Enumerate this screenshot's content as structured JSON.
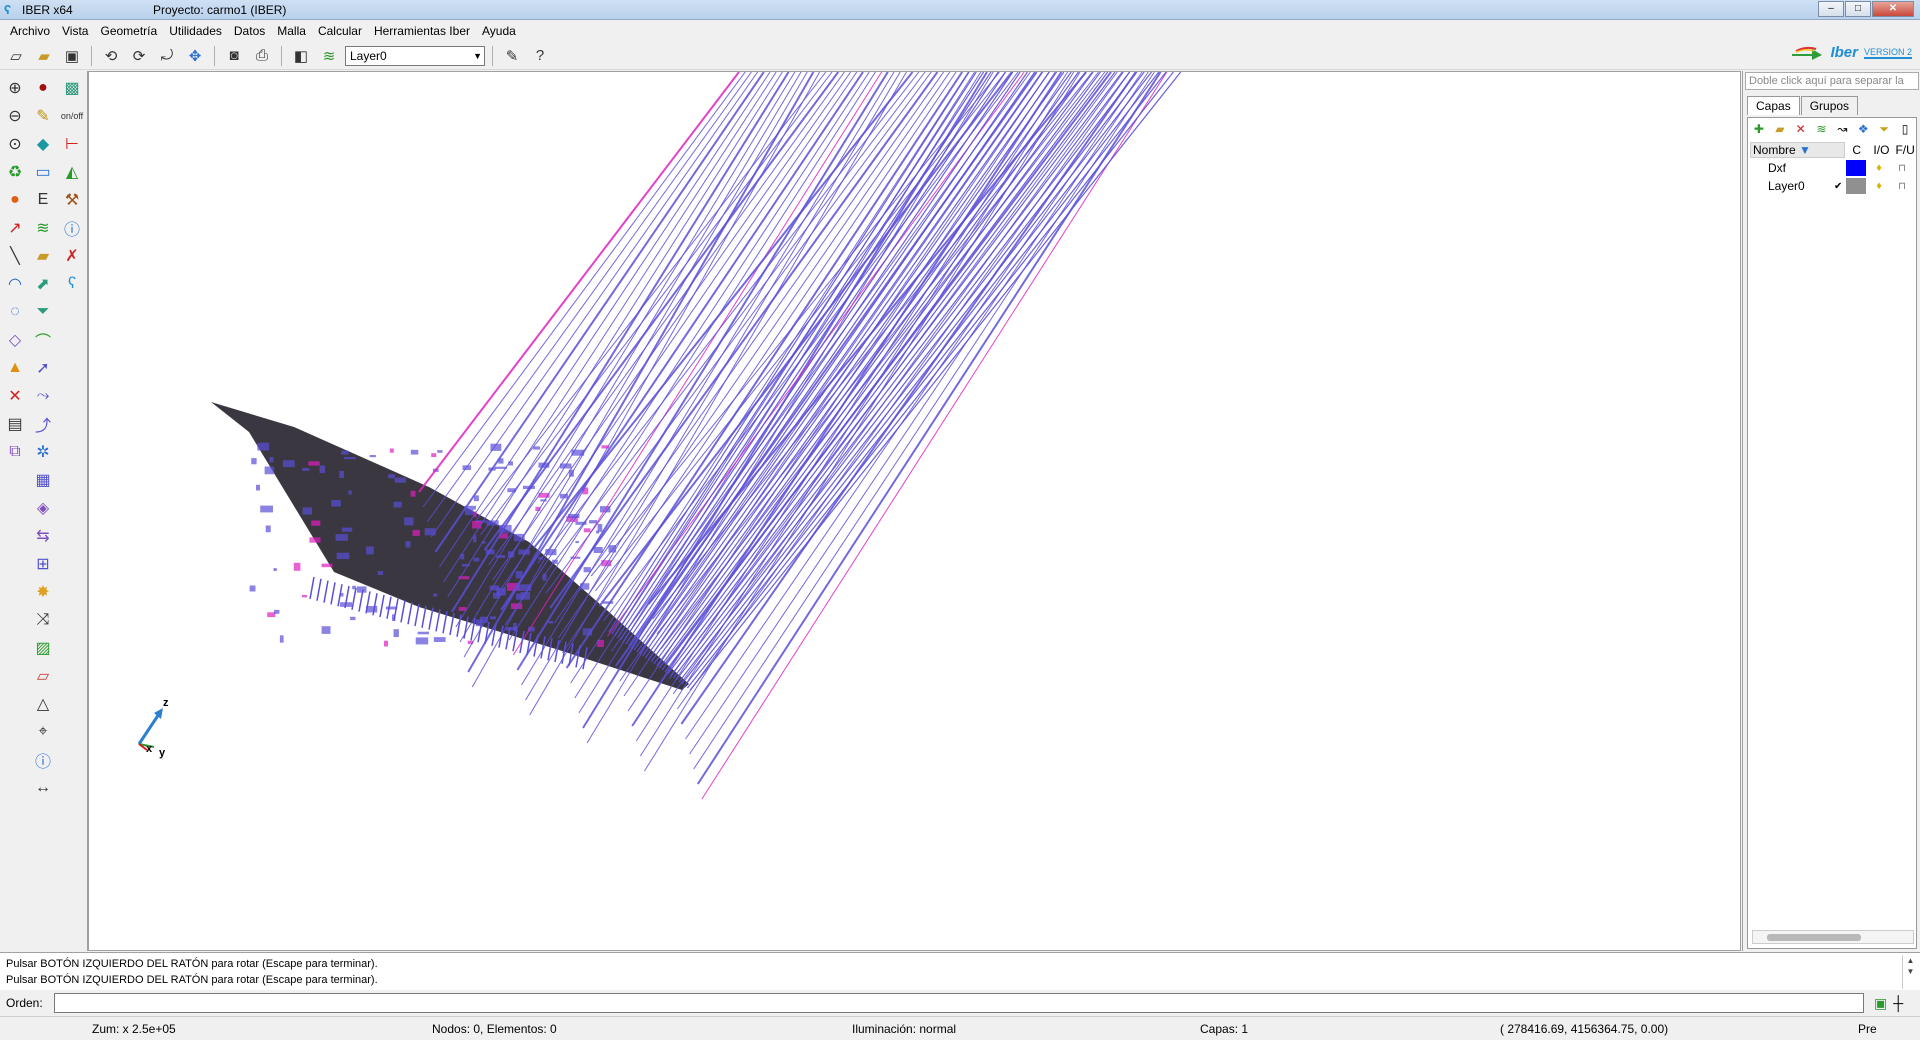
{
  "window": {
    "app_title": "IBER x64",
    "project_title": "Proyecto: carmo1 (IBER)",
    "buttons": {
      "minimize": "–",
      "maximize": "□",
      "close": "✕"
    }
  },
  "menu": [
    {
      "label": "Archivo"
    },
    {
      "label": "Vista"
    },
    {
      "label": "Geometría"
    },
    {
      "label": "Utilidades"
    },
    {
      "label": "Datos"
    },
    {
      "label": "Malla"
    },
    {
      "label": "Calcular"
    },
    {
      "label": "Herramientas Iber"
    },
    {
      "label": "Ayuda"
    }
  ],
  "toolbar": {
    "layer_value": "Layer0",
    "icons": [
      "new-file-icon",
      "open-folder-icon",
      "save-icon",
      "rotate-icon",
      "rotate-screen-icon",
      "rotate-center-icon",
      "pan-icon",
      "camera-icon",
      "print-icon",
      "layers-icon",
      "layers-stack-icon",
      "edit-icon",
      "help-icon"
    ],
    "brand": {
      "name": "Iber",
      "version": "VERSION 2"
    }
  },
  "right_panel": {
    "hint": "Doble click aquí para separar la",
    "tabs": [
      {
        "label": "Capas"
      },
      {
        "label": "Grupos"
      }
    ],
    "columns": {
      "name": "Nombre",
      "color": "C",
      "io": "I/O",
      "fu": "F/U"
    },
    "layers": [
      {
        "name": "Dxf",
        "checked": "",
        "color": "#0000ff"
      },
      {
        "name": "Layer0",
        "checked": "✔",
        "color": "#909090"
      }
    ]
  },
  "axes": {
    "z": "z",
    "x": "x",
    "y": "y"
  },
  "messages": [
    "Pulsar BOTÓN IZQUIERDO DEL RATÓN para rotar (Escape para terminar).",
    "Pulsar BOTÓN IZQUIERDO DEL RATÓN para rotar (Escape para terminar)."
  ],
  "command": {
    "label": "Orden:",
    "value": ""
  },
  "status": {
    "zoom": "Zum: x 2.5e+05",
    "nodes": "Nodos: 0, Elementos: 0",
    "lighting": "Iluminación: normal",
    "layers": "Capas: 1",
    "coords": "( 278416.69, 4156364.75, 0.00)",
    "mode": "Pre"
  },
  "colors": {
    "mesh_line": "#5a4fd8",
    "mesh_highlight": "#e020c0",
    "terrain_dark": "#2a2630",
    "axis_z": "#2a7fd0",
    "axis_y": "#2a9a2a",
    "axis_x": "#d02020"
  }
}
